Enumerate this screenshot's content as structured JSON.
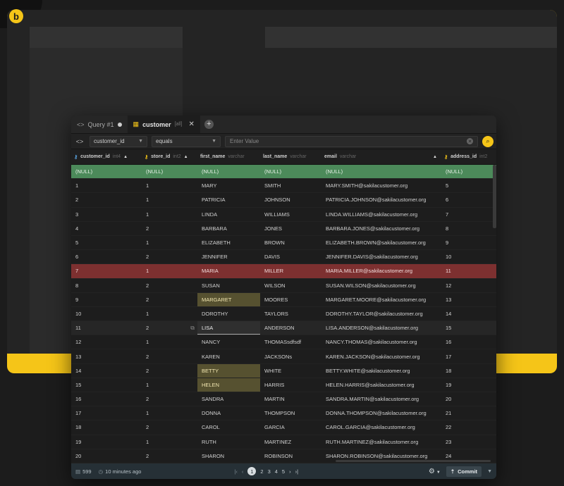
{
  "tabs": [
    {
      "label": "Query #1",
      "type": "",
      "active": false
    },
    {
      "label": "customer",
      "type": "[all]",
      "active": true
    }
  ],
  "filter": {
    "column": "customer_id",
    "operator": "equals",
    "placeholder": "Enter Value"
  },
  "columns": [
    {
      "name": "customer_id",
      "type": "int4",
      "key": "pk",
      "sort": "asc"
    },
    {
      "name": "store_id",
      "type": "int2",
      "key": "fk",
      "sort": "asc"
    },
    {
      "name": "first_name",
      "type": "varchar",
      "key": "",
      "sort": ""
    },
    {
      "name": "last_name",
      "type": "varchar",
      "key": "",
      "sort": ""
    },
    {
      "name": "email",
      "type": "varchar",
      "key": "",
      "sort": "asc"
    },
    {
      "name": "address_id",
      "type": "int2",
      "key": "fk",
      "sort": ""
    }
  ],
  "rows": [
    {
      "state": "new",
      "cells": [
        "(NULL)",
        "(NULL)",
        "(NULL)",
        "(NULL)",
        "(NULL)",
        "(NULL)"
      ]
    },
    {
      "state": "",
      "cells": [
        "1",
        "1",
        "MARY",
        "SMITH",
        "MARY.SMITH@sakilacustomer.org",
        "5"
      ]
    },
    {
      "state": "",
      "cells": [
        "2",
        "1",
        "PATRICIA",
        "JOHNSON",
        "PATRICIA.JOHNSON@sakilacustomer.org",
        "6"
      ]
    },
    {
      "state": "",
      "cells": [
        "3",
        "1",
        "LINDA",
        "WILLIAMS",
        "LINDA.WILLIAMS@sakilacustomer.org",
        "7"
      ]
    },
    {
      "state": "",
      "cells": [
        "4",
        "2",
        "BARBARA",
        "JONES",
        "BARBARA.JONES@sakilacustomer.org",
        "8"
      ]
    },
    {
      "state": "",
      "cells": [
        "5",
        "1",
        "ELIZABETH",
        "BROWN",
        "ELIZABETH.BROWN@sakilacustomer.org",
        "9"
      ]
    },
    {
      "state": "",
      "cells": [
        "6",
        "2",
        "JENNIFER",
        "DAVIS",
        "JENNIFER.DAVIS@sakilacustomer.org",
        "10"
      ]
    },
    {
      "state": "deleted",
      "cells": [
        "7",
        "1",
        "MARIA",
        "MILLER",
        "MARIA.MILLER@sakilacustomer.org",
        "11"
      ]
    },
    {
      "state": "",
      "cells": [
        "8",
        "2",
        "SUSAN",
        "WILSON",
        "SUSAN.WILSON@sakilacustomer.org",
        "12"
      ]
    },
    {
      "state": "changed-first",
      "cells": [
        "9",
        "2",
        "MARGARET",
        "MOORES",
        "MARGARET.MOORE@sakilacustomer.org",
        "13"
      ]
    },
    {
      "state": "",
      "cells": [
        "10",
        "1",
        "DOROTHY",
        "TAYLORS",
        "DOROTHY.TAYLOR@sakilacustomer.org",
        "14"
      ]
    },
    {
      "state": "editing",
      "cells": [
        "11",
        "2",
        "LISA",
        "ANDERSON",
        "LISA.ANDERSON@sakilacustomer.org",
        "15"
      ]
    },
    {
      "state": "",
      "cells": [
        "12",
        "1",
        "NANCY",
        "THOMASsdfsdf",
        "NANCY.THOMAS@sakilacustomer.org",
        "16"
      ]
    },
    {
      "state": "",
      "cells": [
        "13",
        "2",
        "KAREN",
        "JACKSONs",
        "KAREN.JACKSON@sakilacustomer.org",
        "17"
      ]
    },
    {
      "state": "changed-first",
      "cells": [
        "14",
        "2",
        "BETTY",
        "WHITE",
        "BETTY.WHITE@sakilacustomer.org",
        "18"
      ]
    },
    {
      "state": "changed-first",
      "cells": [
        "15",
        "1",
        "HELEN",
        "HARRIS",
        "HELEN.HARRIS@sakilacustomer.org",
        "19"
      ]
    },
    {
      "state": "",
      "cells": [
        "16",
        "2",
        "SANDRA",
        "MARTIN",
        "SANDRA.MARTIN@sakilacustomer.org",
        "20"
      ]
    },
    {
      "state": "",
      "cells": [
        "17",
        "1",
        "DONNA",
        "THOMPSON",
        "DONNA.THOMPSON@sakilacustomer.org",
        "21"
      ]
    },
    {
      "state": "",
      "cells": [
        "18",
        "2",
        "CAROL",
        "GARCIA",
        "CAROL.GARCIA@sakilacustomer.org",
        "22"
      ]
    },
    {
      "state": "",
      "cells": [
        "19",
        "1",
        "RUTH",
        "MARTINEZ",
        "RUTH.MARTINEZ@sakilacustomer.org",
        "23"
      ]
    },
    {
      "state": "",
      "cells": [
        "20",
        "2",
        "SHARON",
        "ROBINSON",
        "SHARON.ROBINSON@sakilacustomer.org",
        "24"
      ]
    }
  ],
  "status": {
    "row_count": "599",
    "time_ago": "10 minutes ago",
    "pages": [
      "1",
      "2",
      "3",
      "4",
      "5"
    ],
    "current_page": "1",
    "commit_label": "Commit"
  },
  "colors": {
    "accent": "#f5c518",
    "new_row": "#4c8a5a",
    "deleted_row": "#7d3030",
    "changed_cell": "#565130"
  },
  "icons": [
    "logo-icon",
    "code-icon",
    "grid-icon",
    "search-icon",
    "clear-icon",
    "key-icon",
    "gear-icon",
    "clock-icon",
    "rows-icon",
    "edit-icon"
  ]
}
